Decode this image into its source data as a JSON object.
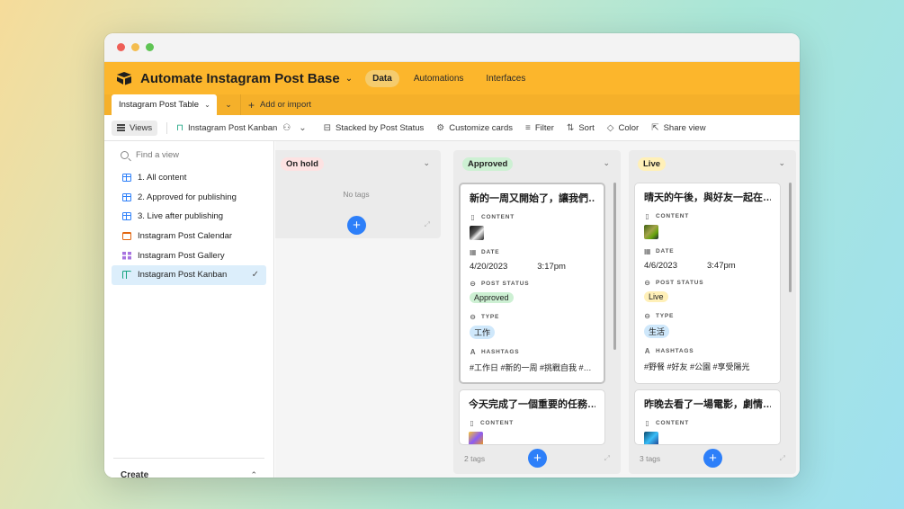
{
  "window": {
    "base_title": "Automate Instagram Post Base",
    "nav": {
      "data": "Data",
      "automations": "Automations",
      "interfaces": "Interfaces"
    }
  },
  "tabs": {
    "table": "Instagram Post Table",
    "add_import": "Add or import"
  },
  "toolbar": {
    "views": "Views",
    "view_name": "Instagram Post Kanban",
    "stacked": "Stacked by Post Status",
    "customize": "Customize cards",
    "filter": "Filter",
    "sort": "Sort",
    "color": "Color",
    "share": "Share view"
  },
  "sidebar": {
    "find_placeholder": "Find a view",
    "views": [
      {
        "label": "1. All content",
        "icon": "grid-icon"
      },
      {
        "label": "2. Approved for publishing",
        "icon": "grid-icon"
      },
      {
        "label": "3. Live after publishing",
        "icon": "grid-icon"
      },
      {
        "label": "Instagram Post Calendar",
        "icon": "calendar-icon"
      },
      {
        "label": "Instagram Post Gallery",
        "icon": "gallery-icon"
      },
      {
        "label": "Instagram Post Kanban",
        "icon": "kanban-icon",
        "selected": true
      }
    ],
    "create": "Create"
  },
  "board": {
    "columns": [
      {
        "label": "On hold",
        "color": "#fde2e2",
        "empty_text": "No tags"
      },
      {
        "label": "Approved",
        "color": "#cdf0d3",
        "footer": "2 tags",
        "cards": [
          {
            "title": "新的一周又開始了，讓我們…",
            "content_label": "CONTENT",
            "date_label": "DATE",
            "date": "4/20/2023",
            "time": "3:17pm",
            "status_label": "POST STATUS",
            "status": "Approved",
            "status_color": "#cdf0d3",
            "type_label": "TYPE",
            "type": "工作",
            "type_color": "#cfe8fb",
            "hashtags_label": "HASHTAGS",
            "hashtags": "#工作日 #新的一周 #挑戰自我 #…"
          },
          {
            "title": "今天完成了一個重要的任務…",
            "content_label": "CONTENT"
          }
        ]
      },
      {
        "label": "Live",
        "color": "#fff0b8",
        "footer": "3 tags",
        "cards": [
          {
            "title": "晴天的午後，與好友一起在…",
            "content_label": "CONTENT",
            "date_label": "DATE",
            "date": "4/6/2023",
            "time": "3:47pm",
            "status_label": "POST STATUS",
            "status": "Live",
            "status_color": "#fff0b8",
            "type_label": "TYPE",
            "type": "生活",
            "type_color": "#cfe8fb",
            "hashtags_label": "HASHTAGS",
            "hashtags": "#野餐 #好友 #公園 #享受陽光"
          },
          {
            "title": "昨晚去看了一場電影，劇情…",
            "content_label": "CONTENT"
          }
        ]
      }
    ],
    "add_symbol": "+"
  }
}
